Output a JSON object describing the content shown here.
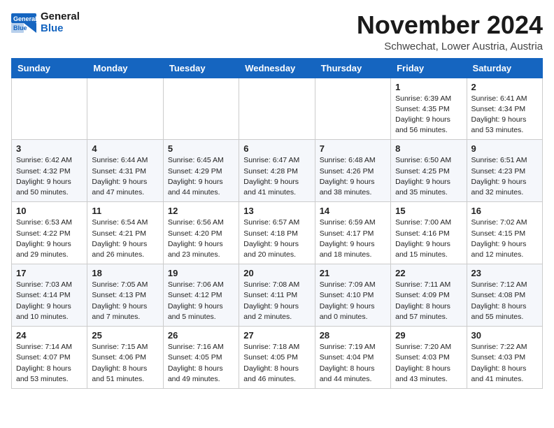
{
  "header": {
    "logo_line1": "General",
    "logo_line2": "Blue",
    "month_title": "November 2024",
    "location": "Schwechat, Lower Austria, Austria"
  },
  "weekdays": [
    "Sunday",
    "Monday",
    "Tuesday",
    "Wednesday",
    "Thursday",
    "Friday",
    "Saturday"
  ],
  "weeks": [
    [
      {
        "day": "",
        "info": ""
      },
      {
        "day": "",
        "info": ""
      },
      {
        "day": "",
        "info": ""
      },
      {
        "day": "",
        "info": ""
      },
      {
        "day": "",
        "info": ""
      },
      {
        "day": "1",
        "info": "Sunrise: 6:39 AM\nSunset: 4:35 PM\nDaylight: 9 hours\nand 56 minutes."
      },
      {
        "day": "2",
        "info": "Sunrise: 6:41 AM\nSunset: 4:34 PM\nDaylight: 9 hours\nand 53 minutes."
      }
    ],
    [
      {
        "day": "3",
        "info": "Sunrise: 6:42 AM\nSunset: 4:32 PM\nDaylight: 9 hours\nand 50 minutes."
      },
      {
        "day": "4",
        "info": "Sunrise: 6:44 AM\nSunset: 4:31 PM\nDaylight: 9 hours\nand 47 minutes."
      },
      {
        "day": "5",
        "info": "Sunrise: 6:45 AM\nSunset: 4:29 PM\nDaylight: 9 hours\nand 44 minutes."
      },
      {
        "day": "6",
        "info": "Sunrise: 6:47 AM\nSunset: 4:28 PM\nDaylight: 9 hours\nand 41 minutes."
      },
      {
        "day": "7",
        "info": "Sunrise: 6:48 AM\nSunset: 4:26 PM\nDaylight: 9 hours\nand 38 minutes."
      },
      {
        "day": "8",
        "info": "Sunrise: 6:50 AM\nSunset: 4:25 PM\nDaylight: 9 hours\nand 35 minutes."
      },
      {
        "day": "9",
        "info": "Sunrise: 6:51 AM\nSunset: 4:23 PM\nDaylight: 9 hours\nand 32 minutes."
      }
    ],
    [
      {
        "day": "10",
        "info": "Sunrise: 6:53 AM\nSunset: 4:22 PM\nDaylight: 9 hours\nand 29 minutes."
      },
      {
        "day": "11",
        "info": "Sunrise: 6:54 AM\nSunset: 4:21 PM\nDaylight: 9 hours\nand 26 minutes."
      },
      {
        "day": "12",
        "info": "Sunrise: 6:56 AM\nSunset: 4:20 PM\nDaylight: 9 hours\nand 23 minutes."
      },
      {
        "day": "13",
        "info": "Sunrise: 6:57 AM\nSunset: 4:18 PM\nDaylight: 9 hours\nand 20 minutes."
      },
      {
        "day": "14",
        "info": "Sunrise: 6:59 AM\nSunset: 4:17 PM\nDaylight: 9 hours\nand 18 minutes."
      },
      {
        "day": "15",
        "info": "Sunrise: 7:00 AM\nSunset: 4:16 PM\nDaylight: 9 hours\nand 15 minutes."
      },
      {
        "day": "16",
        "info": "Sunrise: 7:02 AM\nSunset: 4:15 PM\nDaylight: 9 hours\nand 12 minutes."
      }
    ],
    [
      {
        "day": "17",
        "info": "Sunrise: 7:03 AM\nSunset: 4:14 PM\nDaylight: 9 hours\nand 10 minutes."
      },
      {
        "day": "18",
        "info": "Sunrise: 7:05 AM\nSunset: 4:13 PM\nDaylight: 9 hours\nand 7 minutes."
      },
      {
        "day": "19",
        "info": "Sunrise: 7:06 AM\nSunset: 4:12 PM\nDaylight: 9 hours\nand 5 minutes."
      },
      {
        "day": "20",
        "info": "Sunrise: 7:08 AM\nSunset: 4:11 PM\nDaylight: 9 hours\nand 2 minutes."
      },
      {
        "day": "21",
        "info": "Sunrise: 7:09 AM\nSunset: 4:10 PM\nDaylight: 9 hours\nand 0 minutes."
      },
      {
        "day": "22",
        "info": "Sunrise: 7:11 AM\nSunset: 4:09 PM\nDaylight: 8 hours\nand 57 minutes."
      },
      {
        "day": "23",
        "info": "Sunrise: 7:12 AM\nSunset: 4:08 PM\nDaylight: 8 hours\nand 55 minutes."
      }
    ],
    [
      {
        "day": "24",
        "info": "Sunrise: 7:14 AM\nSunset: 4:07 PM\nDaylight: 8 hours\nand 53 minutes."
      },
      {
        "day": "25",
        "info": "Sunrise: 7:15 AM\nSunset: 4:06 PM\nDaylight: 8 hours\nand 51 minutes."
      },
      {
        "day": "26",
        "info": "Sunrise: 7:16 AM\nSunset: 4:05 PM\nDaylight: 8 hours\nand 49 minutes."
      },
      {
        "day": "27",
        "info": "Sunrise: 7:18 AM\nSunset: 4:05 PM\nDaylight: 8 hours\nand 46 minutes."
      },
      {
        "day": "28",
        "info": "Sunrise: 7:19 AM\nSunset: 4:04 PM\nDaylight: 8 hours\nand 44 minutes."
      },
      {
        "day": "29",
        "info": "Sunrise: 7:20 AM\nSunset: 4:03 PM\nDaylight: 8 hours\nand 43 minutes."
      },
      {
        "day": "30",
        "info": "Sunrise: 7:22 AM\nSunset: 4:03 PM\nDaylight: 8 hours\nand 41 minutes."
      }
    ]
  ]
}
